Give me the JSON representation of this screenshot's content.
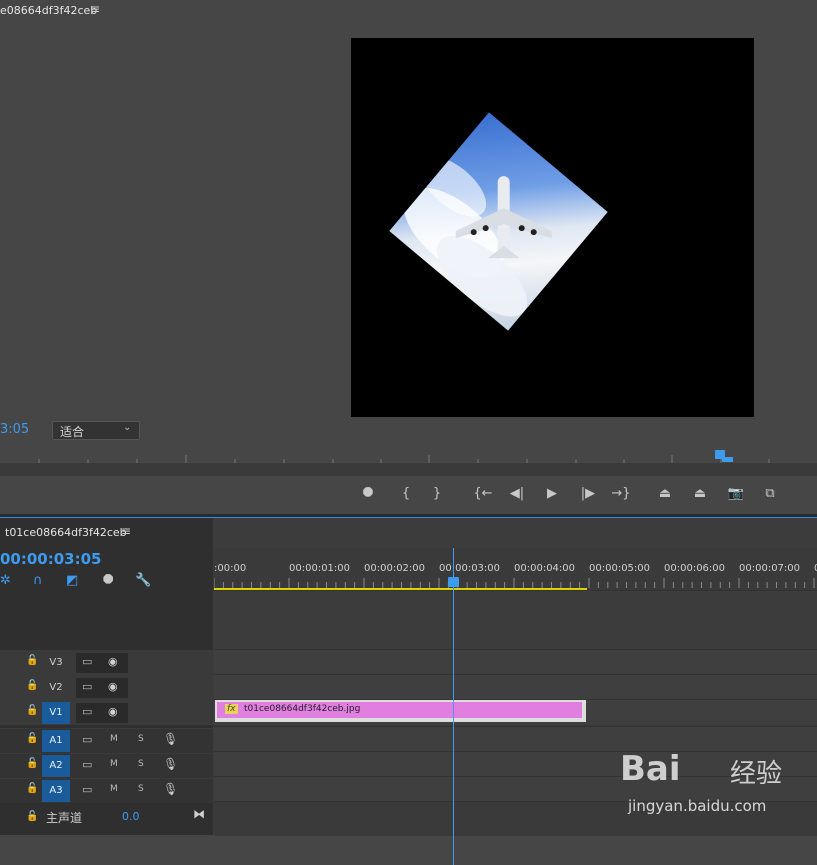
{
  "monitor": {
    "tab_title": "e08664df3f42ceb",
    "menu_icon": "≡",
    "timecode": "3:05",
    "fit": {
      "label": "适合",
      "chevron": "⌄"
    },
    "transport": [
      {
        "name": "add-marker-button",
        "glyph": "⯃"
      },
      {
        "name": "mark-in-button",
        "glyph": "{"
      },
      {
        "name": "mark-out-button",
        "glyph": "}"
      },
      {
        "name": "go-to-in-button",
        "glyph": "{←"
      },
      {
        "name": "step-back-button",
        "glyph": "◀|"
      },
      {
        "name": "play-button",
        "glyph": "▶"
      },
      {
        "name": "step-forward-button",
        "glyph": "|▶"
      },
      {
        "name": "go-to-out-button",
        "glyph": "→}"
      },
      {
        "name": "lift-button",
        "glyph": "⏏"
      },
      {
        "name": "extract-button",
        "glyph": "⏏"
      },
      {
        "name": "export-frame-button",
        "glyph": "📷"
      },
      {
        "name": "compare-view-button",
        "glyph": "⧉"
      }
    ]
  },
  "timeline": {
    "tab_title": "t01ce08664df3f42ceb",
    "menu_icon": "≡",
    "timecode": "00:00:03:05",
    "ruler_labels": [
      ":00:00",
      "00:00:01:00",
      "00:00:02:00",
      "00:00:03:00",
      "00:00:04:00",
      "00:00:05:00",
      "00:00:06:00",
      "00:00:07:00",
      "00:0"
    ],
    "video_tracks": [
      {
        "name": "V3",
        "active": false
      },
      {
        "name": "V2",
        "active": false
      },
      {
        "name": "V1",
        "active": true
      }
    ],
    "audio_tracks": [
      {
        "name": "A1",
        "m": "M",
        "s": "S"
      },
      {
        "name": "A2",
        "m": "M",
        "s": "S"
      },
      {
        "name": "A3",
        "m": "M",
        "s": "S"
      }
    ],
    "clip": {
      "fx": "fx",
      "name": "t01ce08664df3f42ceb.jpg"
    },
    "master": {
      "label": "主声道",
      "value": "0.0"
    }
  },
  "watermark": {
    "logo": "Bai",
    "cn": "经验",
    "url": "jingyan.baidu.com"
  },
  "colors": {
    "accent": "#3d9bf0",
    "clip": "#e07fe0",
    "workarea": "#ddd200"
  }
}
